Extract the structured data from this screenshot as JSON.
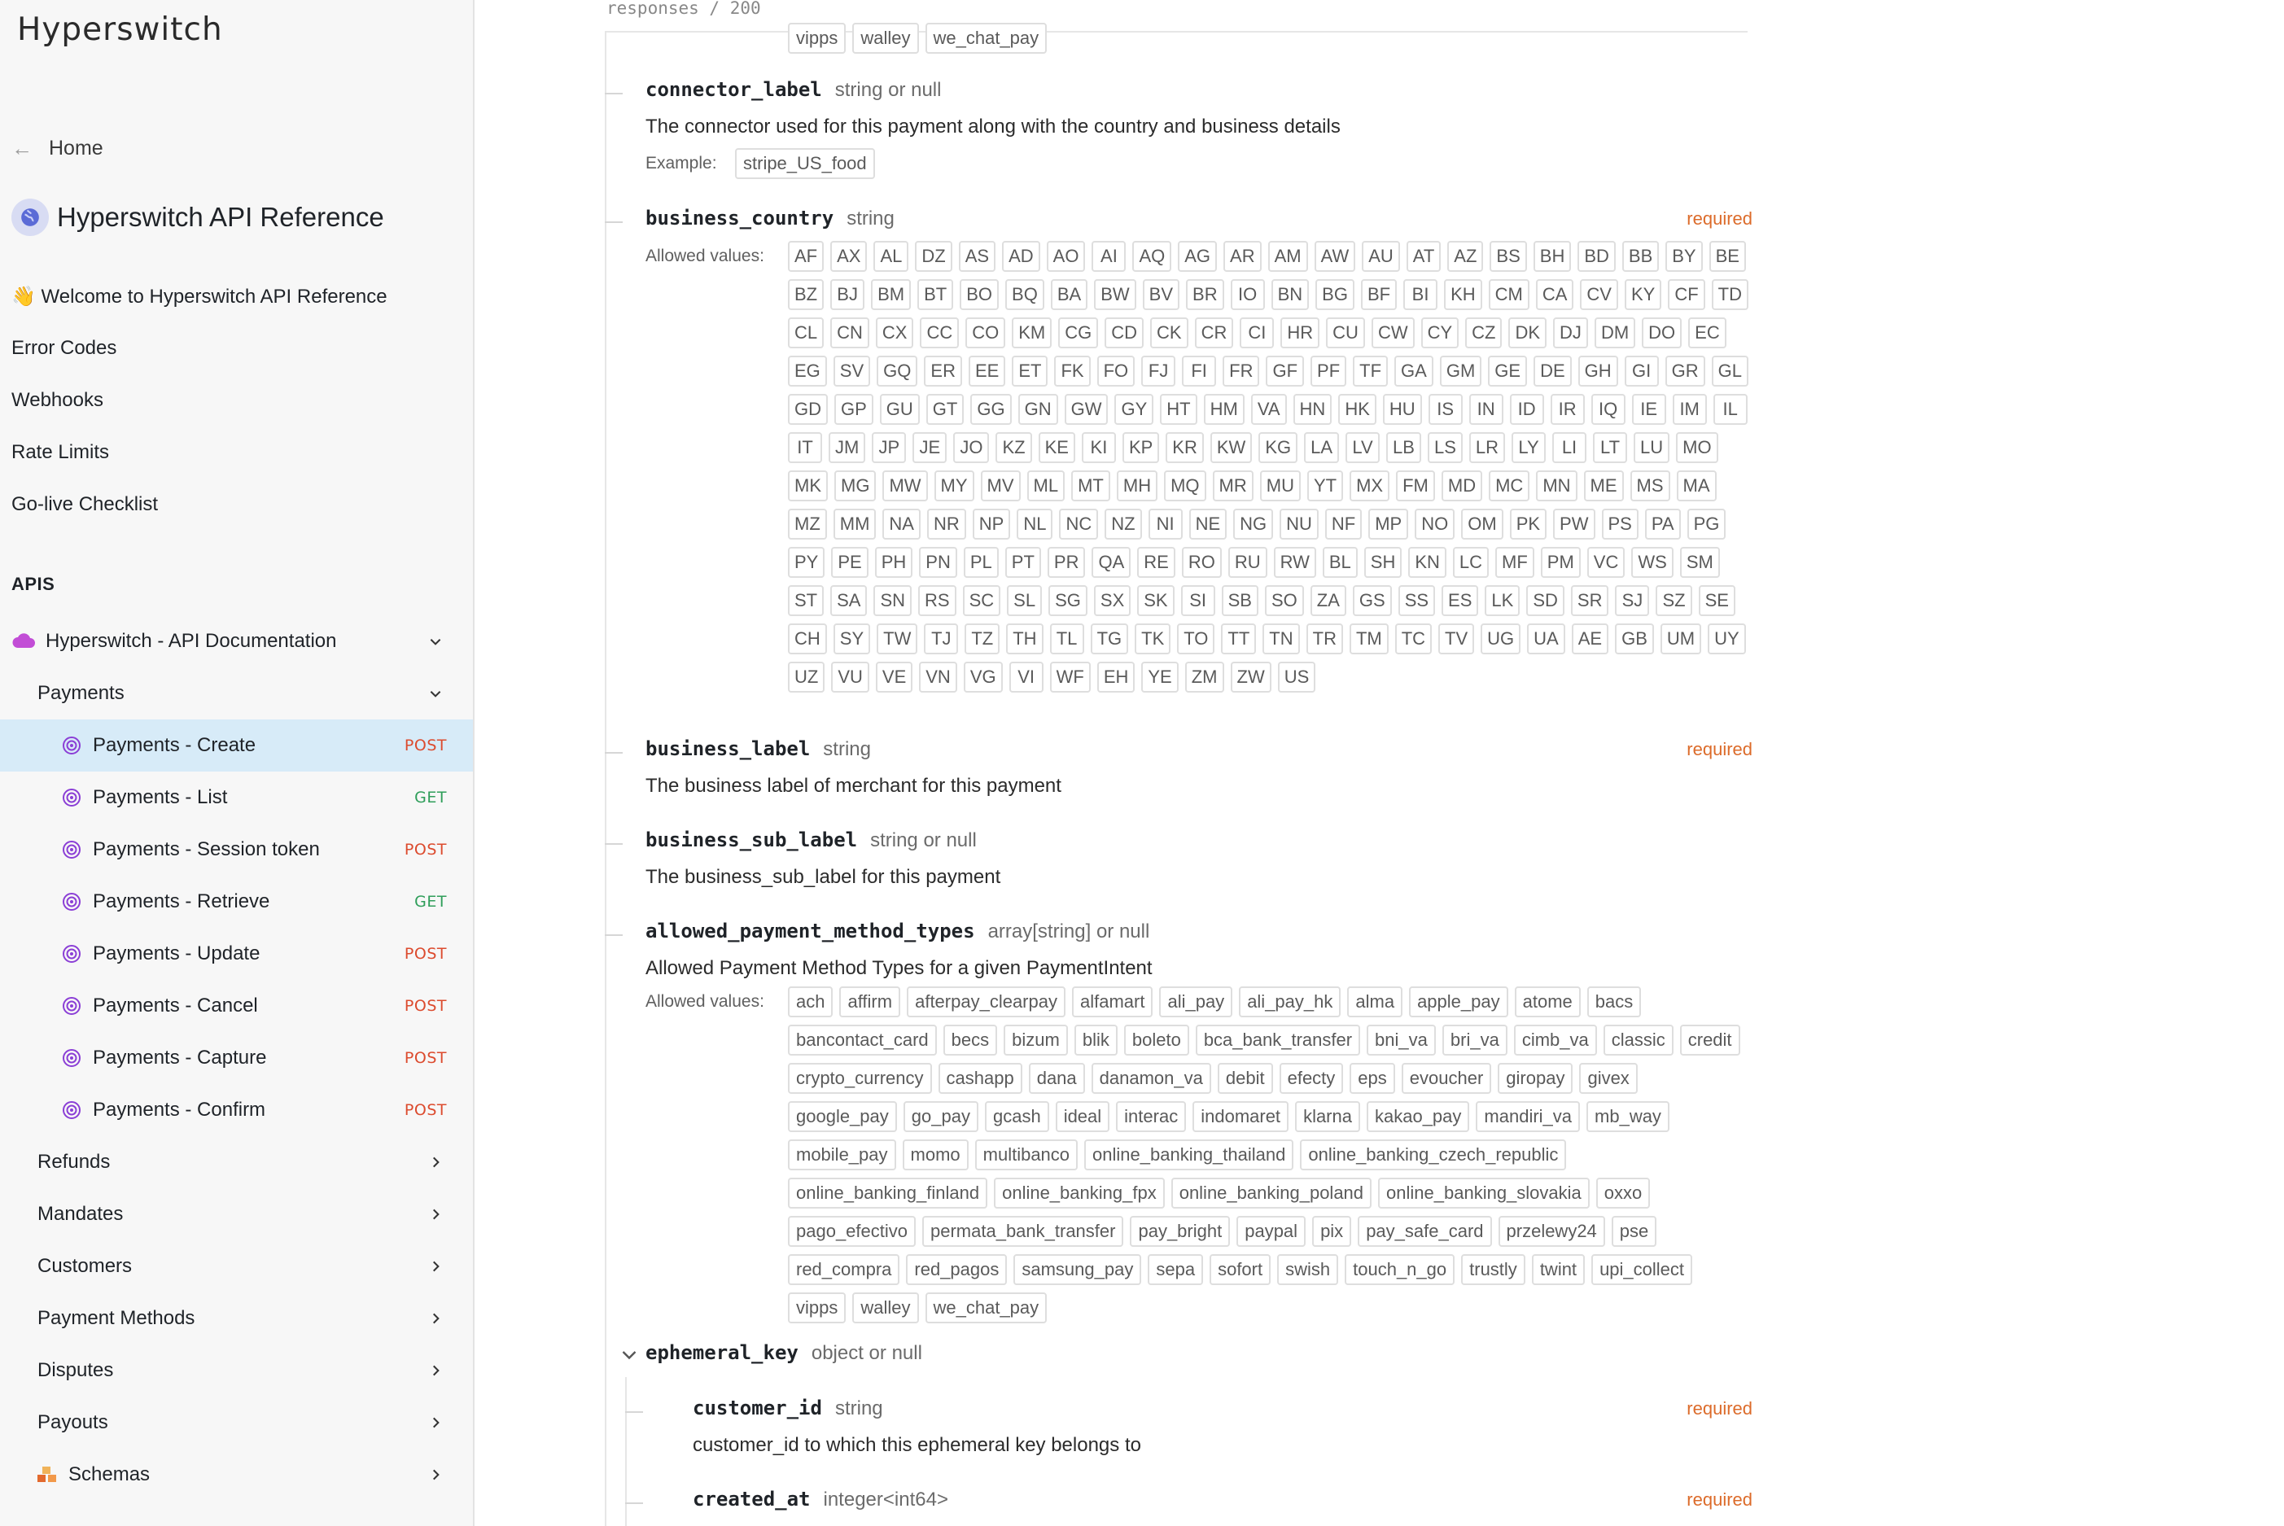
{
  "brand": "Hyperswitch",
  "nav": {
    "home": "Home",
    "api_title": "Hyperswitch API Reference",
    "links": [
      "👋 Welcome to Hyperswitch API Reference",
      "Error Codes",
      "Webhooks",
      "Rate Limits",
      "Go-live Checklist"
    ],
    "apis_heading": "APIS",
    "api_doc": "Hyperswitch - API Documentation",
    "payments": "Payments",
    "endpoints": [
      {
        "label": "Payments - Create",
        "method": "POST"
      },
      {
        "label": "Payments - List",
        "method": "GET"
      },
      {
        "label": "Payments - Session token",
        "method": "POST"
      },
      {
        "label": "Payments - Retrieve",
        "method": "GET"
      },
      {
        "label": "Payments - Update",
        "method": "POST"
      },
      {
        "label": "Payments - Cancel",
        "method": "POST"
      },
      {
        "label": "Payments - Capture",
        "method": "POST"
      },
      {
        "label": "Payments - Confirm",
        "method": "POST"
      }
    ],
    "groups": [
      "Refunds",
      "Mandates",
      "Customers",
      "Payment Methods",
      "Disputes",
      "Payouts",
      "Schemas"
    ],
    "active_endpoint": "Payments - Create"
  },
  "main": {
    "breadcrumb": "responses / 200",
    "top_chips": [
      "vipps",
      "walley",
      "we_chat_pay"
    ],
    "connector_label": {
      "name": "connector_label",
      "type": "string or null",
      "description": "The connector used for this payment along with the country and business details",
      "example_label": "Example:",
      "example": "stripe_US_food"
    },
    "business_country": {
      "name": "business_country",
      "type": "string",
      "required": "required",
      "allowed_label": "Allowed values:",
      "values": [
        "AF",
        "AX",
        "AL",
        "DZ",
        "AS",
        "AD",
        "AO",
        "AI",
        "AQ",
        "AG",
        "AR",
        "AM",
        "AW",
        "AU",
        "AT",
        "AZ",
        "BS",
        "BH",
        "BD",
        "BB",
        "BY",
        "BE",
        "BZ",
        "BJ",
        "BM",
        "BT",
        "BO",
        "BQ",
        "BA",
        "BW",
        "BV",
        "BR",
        "IO",
        "BN",
        "BG",
        "BF",
        "BI",
        "KH",
        "CM",
        "CA",
        "CV",
        "KY",
        "CF",
        "TD",
        "CL",
        "CN",
        "CX",
        "CC",
        "CO",
        "KM",
        "CG",
        "CD",
        "CK",
        "CR",
        "CI",
        "HR",
        "CU",
        "CW",
        "CY",
        "CZ",
        "DK",
        "DJ",
        "DM",
        "DO",
        "EC",
        "EG",
        "SV",
        "GQ",
        "ER",
        "EE",
        "ET",
        "FK",
        "FO",
        "FJ",
        "FI",
        "FR",
        "GF",
        "PF",
        "TF",
        "GA",
        "GM",
        "GE",
        "DE",
        "GH",
        "GI",
        "GR",
        "GL",
        "GD",
        "GP",
        "GU",
        "GT",
        "GG",
        "GN",
        "GW",
        "GY",
        "HT",
        "HM",
        "VA",
        "HN",
        "HK",
        "HU",
        "IS",
        "IN",
        "ID",
        "IR",
        "IQ",
        "IE",
        "IM",
        "IL",
        "IT",
        "JM",
        "JP",
        "JE",
        "JO",
        "KZ",
        "KE",
        "KI",
        "KP",
        "KR",
        "KW",
        "KG",
        "LA",
        "LV",
        "LB",
        "LS",
        "LR",
        "LY",
        "LI",
        "LT",
        "LU",
        "MO",
        "MK",
        "MG",
        "MW",
        "MY",
        "MV",
        "ML",
        "MT",
        "MH",
        "MQ",
        "MR",
        "MU",
        "YT",
        "MX",
        "FM",
        "MD",
        "MC",
        "MN",
        "ME",
        "MS",
        "MA",
        "MZ",
        "MM",
        "NA",
        "NR",
        "NP",
        "NL",
        "NC",
        "NZ",
        "NI",
        "NE",
        "NG",
        "NU",
        "NF",
        "MP",
        "NO",
        "OM",
        "PK",
        "PW",
        "PS",
        "PA",
        "PG",
        "PY",
        "PE",
        "PH",
        "PN",
        "PL",
        "PT",
        "PR",
        "QA",
        "RE",
        "RO",
        "RU",
        "RW",
        "BL",
        "SH",
        "KN",
        "LC",
        "MF",
        "PM",
        "VC",
        "WS",
        "SM",
        "ST",
        "SA",
        "SN",
        "RS",
        "SC",
        "SL",
        "SG",
        "SX",
        "SK",
        "SI",
        "SB",
        "SO",
        "ZA",
        "GS",
        "SS",
        "ES",
        "LK",
        "SD",
        "SR",
        "SJ",
        "SZ",
        "SE",
        "CH",
        "SY",
        "TW",
        "TJ",
        "TZ",
        "TH",
        "TL",
        "TG",
        "TK",
        "TO",
        "TT",
        "TN",
        "TR",
        "TM",
        "TC",
        "TV",
        "UG",
        "UA",
        "AE",
        "GB",
        "UM",
        "UY",
        "UZ",
        "VU",
        "VE",
        "VN",
        "VG",
        "VI",
        "WF",
        "EH",
        "YE",
        "ZM",
        "ZW",
        "US"
      ]
    },
    "business_label": {
      "name": "business_label",
      "type": "string",
      "required": "required",
      "description": "The business label of merchant for this payment"
    },
    "business_sub_label": {
      "name": "business_sub_label",
      "type": "string or null",
      "description": "The business_sub_label for this payment"
    },
    "allowed_payment_method_types": {
      "name": "allowed_payment_method_types",
      "type": "array[string] or null",
      "description": "Allowed Payment Method Types for a given PaymentIntent",
      "allowed_label": "Allowed values:",
      "values": [
        "ach",
        "affirm",
        "afterpay_clearpay",
        "alfamart",
        "ali_pay",
        "ali_pay_hk",
        "alma",
        "apple_pay",
        "atome",
        "bacs",
        "bancontact_card",
        "becs",
        "bizum",
        "blik",
        "boleto",
        "bca_bank_transfer",
        "bni_va",
        "bri_va",
        "cimb_va",
        "classic",
        "credit",
        "crypto_currency",
        "cashapp",
        "dana",
        "danamon_va",
        "debit",
        "efecty",
        "eps",
        "evoucher",
        "giropay",
        "givex",
        "google_pay",
        "go_pay",
        "gcash",
        "ideal",
        "interac",
        "indomaret",
        "klarna",
        "kakao_pay",
        "mandiri_va",
        "mb_way",
        "mobile_pay",
        "momo",
        "multibanco",
        "online_banking_thailand",
        "online_banking_czech_republic",
        "online_banking_finland",
        "online_banking_fpx",
        "online_banking_poland",
        "online_banking_slovakia",
        "oxxo",
        "pago_efectivo",
        "permata_bank_transfer",
        "pay_bright",
        "paypal",
        "pix",
        "pay_safe_card",
        "przelewy24",
        "pse",
        "red_compra",
        "red_pagos",
        "samsung_pay",
        "sepa",
        "sofort",
        "swish",
        "touch_n_go",
        "trustly",
        "twint",
        "upi_collect",
        "vipps",
        "walley",
        "we_chat_pay"
      ]
    },
    "ephemeral_key": {
      "name": "ephemeral_key",
      "type": "object or null"
    },
    "customer_id": {
      "name": "customer_id",
      "type": "string",
      "required": "required",
      "description": "customer_id to which this ephemeral key belongs to"
    },
    "created_at": {
      "name": "created_at",
      "type": "integer<int64>",
      "required": "required"
    }
  }
}
